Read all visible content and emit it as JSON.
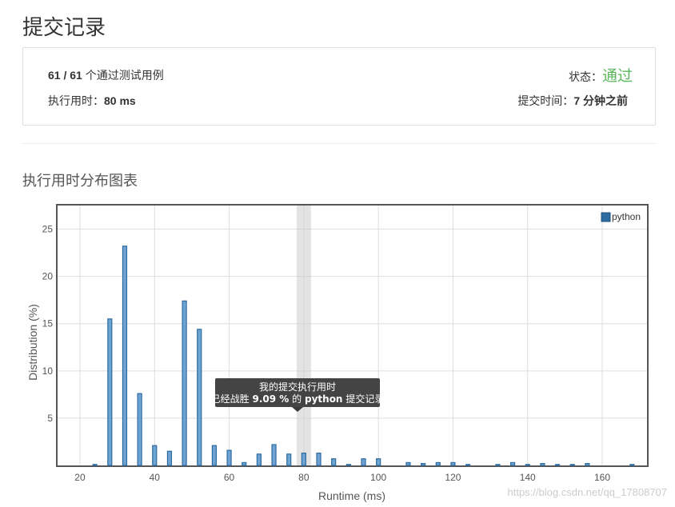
{
  "page_title": "提交记录",
  "summary": {
    "tests_count": "61 / 61",
    "tests_text": "个通过测试用例",
    "runtime_label": "执行用时：",
    "runtime_value": "80 ms",
    "status_label": "状态：",
    "status_value": "通过",
    "status_color": "#5cb85c",
    "submit_time_label": "提交时间：",
    "submit_time_value": "7 分钟之前"
  },
  "section_title": "执行用时分布图表",
  "tooltip": {
    "line1": "我的提交执行用时",
    "line2_prefix": "已经战胜",
    "line2_value": "9.09 %",
    "line2_mid": "的",
    "line2_lang": "python",
    "line2_suffix": "提交记录"
  },
  "watermark": "https://blog.csdn.net/qq_17808707",
  "chart_data": {
    "type": "bar",
    "xlabel": "Runtime (ms)",
    "ylabel": "Distribution (%)",
    "xlim": [
      14,
      172
    ],
    "ylim": [
      0,
      27.5
    ],
    "xticks": [
      20,
      40,
      60,
      80,
      100,
      120,
      140,
      160
    ],
    "yticks": [
      5,
      10,
      15,
      20,
      25
    ],
    "grid": true,
    "legend_position": "top-right",
    "highlight_x": 80,
    "bar_color": "#2d6ca2",
    "series": [
      {
        "name": "python",
        "x": [
          24,
          28,
          32,
          36,
          40,
          44,
          48,
          52,
          56,
          60,
          64,
          68,
          72,
          76,
          80,
          84,
          88,
          92,
          96,
          100,
          108,
          112,
          116,
          120,
          124,
          132,
          136,
          140,
          144,
          148,
          152,
          156,
          168
        ],
        "values": [
          0.1,
          15.5,
          23.2,
          7.6,
          2.1,
          1.5,
          17.4,
          14.4,
          2.1,
          1.6,
          0.3,
          1.2,
          2.2,
          1.2,
          1.3,
          1.3,
          0.7,
          0.1,
          0.7,
          0.7,
          0.3,
          0.2,
          0.3,
          0.3,
          0.1,
          0.1,
          0.3,
          0.1,
          0.2,
          0.1,
          0.1,
          0.2,
          0.1
        ]
      }
    ]
  }
}
